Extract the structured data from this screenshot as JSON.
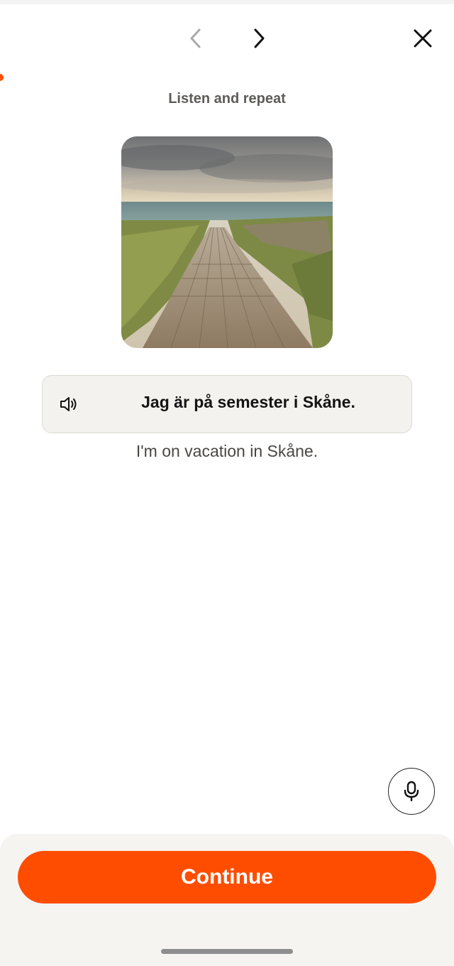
{
  "header": {
    "prev_icon": "chevron-left-icon",
    "next_icon": "chevron-right-icon",
    "close_icon": "close-icon",
    "progress_color": "#ff4d00"
  },
  "exercise": {
    "instruction": "Listen and repeat",
    "image": "beach-boardwalk-photo",
    "phrase": "Jag är på semester i Skåne.",
    "audio_icon": "speaker-icon",
    "translation": "I'm on vacation in Skåne."
  },
  "controls": {
    "mic_icon": "microphone-icon",
    "continue_label": "Continue",
    "accent_color": "#ff4d00"
  }
}
